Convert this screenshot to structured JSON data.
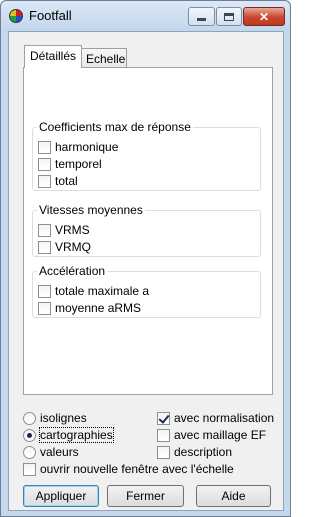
{
  "window": {
    "title": "Footfall",
    "icon": "app-globe-icon",
    "close_glyph": "✕"
  },
  "tabs": [
    {
      "label": "Détaillés",
      "active": true
    },
    {
      "label": "Echelle",
      "active": false
    }
  ],
  "groups": {
    "coefficients": {
      "title": "Coefficients max de réponse",
      "items": [
        {
          "label": "harmonique",
          "checked": false
        },
        {
          "label": "temporel",
          "checked": false
        },
        {
          "label": "total",
          "checked": false
        }
      ]
    },
    "vitesses": {
      "title": "Vitesses moyennes",
      "items": [
        {
          "label": "VRMS",
          "checked": false
        },
        {
          "label": "VRMQ",
          "checked": false
        }
      ]
    },
    "acceleration": {
      "title": "Accélération",
      "items": [
        {
          "label": "totale maximale a",
          "checked": false
        },
        {
          "label": "moyenne aRMS",
          "checked": false
        }
      ]
    }
  },
  "display_mode": {
    "options": [
      {
        "label": "isolignes",
        "selected": false
      },
      {
        "label": "cartographies",
        "selected": true
      },
      {
        "label": "valeurs",
        "selected": false
      }
    ]
  },
  "options": {
    "normalisation": {
      "label": "avec normalisation",
      "checked": true
    },
    "maillage": {
      "label": "avec maillage EF",
      "checked": false
    },
    "description": {
      "label": "description",
      "checked": false
    },
    "new_window": {
      "label": "ouvrir nouvelle fenêtre avec l'échelle",
      "checked": false
    }
  },
  "buttons": {
    "apply": "Appliquer",
    "close": "Fermer",
    "help": "Aide"
  },
  "colors": {
    "frame": "#c5d7ea",
    "client": "#f0f0f0",
    "close_button": "#c9452d"
  }
}
